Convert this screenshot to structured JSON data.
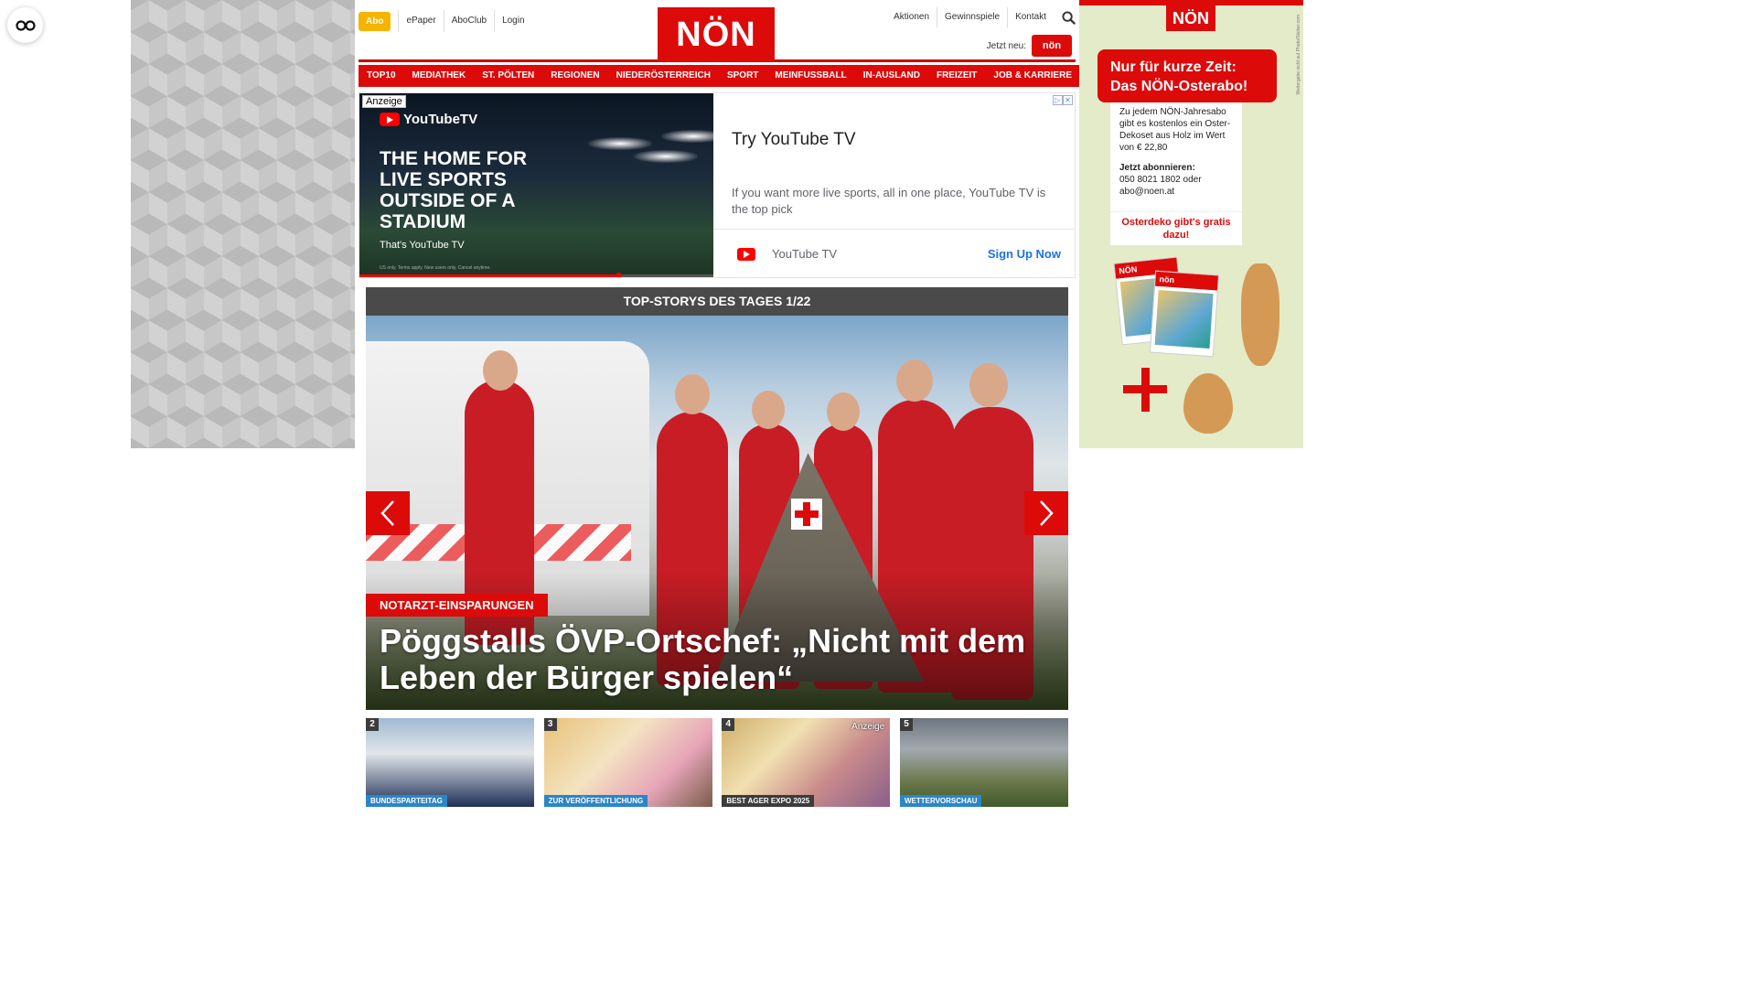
{
  "accessibility": {
    "icon": "glasses-icon"
  },
  "header": {
    "abo_label": "Abo",
    "left_links": [
      "ePaper",
      "AboClub",
      "Login"
    ],
    "logo_text": "NÖN",
    "right_links": [
      "Aktionen",
      "Gewinnspiele",
      "Kontakt"
    ],
    "search_icon": "search-icon",
    "jetzt_neu_label": "Jetzt neu:",
    "jetzt_neu_badge": "nön"
  },
  "nav": {
    "items": [
      "TOP10",
      "MEDIATHEK",
      "ST. PÖLTEN",
      "REGIONEN",
      "NIEDERÖSTERREICH",
      "SPORT",
      "MEINFUSSBALL",
      "IN-AUSLAND",
      "FREIZEIT",
      "JOB & KARRIERE"
    ]
  },
  "ad": {
    "label": "Anzeige",
    "brand": "YouTubeTV",
    "headline": "THE HOME FOR LIVE SPORTS OUTSIDE OF A STADIUM",
    "subline": "That's YouTube TV",
    "fineprint": "US only. Terms apply. New users only. Cancel anytime.",
    "title": "Try YouTube TV",
    "description": "If you want more live sports, all in one place, YouTube TV is the top pick",
    "advertiser": "YouTube TV",
    "cta": "Sign Up Now",
    "progress": 0.73,
    "colors": {
      "youtube_red": "#ff0000",
      "cta_blue": "#1a73e8"
    }
  },
  "top_stories": {
    "header": "TOP-STORYS DES TAGES 1/22",
    "hero": {
      "kicker": "NOTARZT-EINSPARUNGEN",
      "title": "Pöggstalls ÖVP-Ortschef: „Nicht mit dem Leben der Bürger spielen“"
    },
    "prev_icon": "chevron-left-icon",
    "next_icon": "chevron-right-icon",
    "thumbnails": [
      {
        "number": "2",
        "tag": "BUNDESPARTEITAG",
        "ad": ""
      },
      {
        "number": "3",
        "tag": "ZUR VERÖFFENTLICHUNG",
        "ad": ""
      },
      {
        "number": "4",
        "tag": "BEST AGER EXPO 2025",
        "ad": "Anzeige"
      },
      {
        "number": "5",
        "tag": "WETTERVORSCHAU",
        "ad": ""
      }
    ]
  },
  "right_ad": {
    "logo": "NÖN",
    "side_text": "Weitergabe nicht auf Photo/Sticker.com",
    "headline": "Nur für kurze Zeit: Das NÖN-Osterabo!",
    "body": "Zu jedem NÖN-Jahresabo gibt es kostenlos ein Oster-Dekoset aus Holz im Wert von € 22,80",
    "cta_title": "Jetzt abonnieren:",
    "cta_body": "050 8021 1802 oder abo@noen.at",
    "gift": "Osterdeko gibt's gratis dazu!",
    "mag1_label": "NÖN",
    "mag2_label": "nön"
  },
  "colors": {
    "brand_red": "#dd0a0a",
    "abo_yellow": "#f5b400",
    "header_gray": "#4a4a4a"
  }
}
